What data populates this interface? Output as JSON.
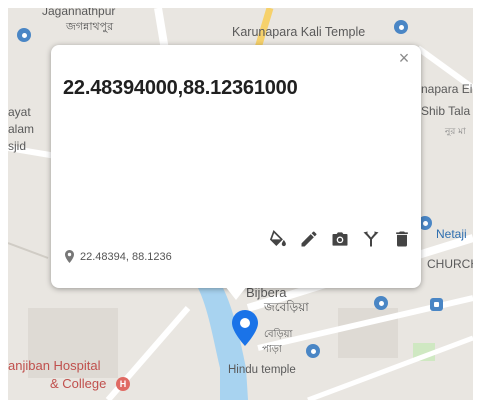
{
  "map": {
    "labels": {
      "jaganathpur_en": "Jagannathpur",
      "jaganathpur_bn": "জগন্নাথপুর",
      "karunapara_kali": "Karunapara Kali Temple",
      "napara_ei": "napara Ei",
      "shib_tala": "Shib Tala",
      "shib_tala_bn": "নুর মা",
      "ayat": "ayat",
      "alam": "alam",
      "sjid": "sjid",
      "netaji": "Netaji",
      "church": "CHURCH",
      "bijbera_en": "Bijbera",
      "bijbera_bn": "জবেড়িয়া",
      "bijbera_sub_bn": "বেড়িয়া",
      "bijbera_sub2_bn": "পাড়া",
      "hindu_temple": "Hindu temple",
      "sanjiban_1": "anjiban Hospital",
      "sanjiban_2": "& College"
    },
    "colors": {
      "land": "#e9e6e1",
      "road_major": "#ffffff",
      "road_yellow": "#f6d16b",
      "water": "#a8d3f0",
      "park": "#cfe8c2",
      "poi_blue": "#4a86c5",
      "poi_red": "#e06a63",
      "marker_blue": "#1a73e8"
    }
  },
  "popup": {
    "title": "22.48394000,88.12361000",
    "coords_short": "22.48394, 88.1236",
    "close_label": "×",
    "actions": [
      "fill-color-icon",
      "edit-icon",
      "camera-icon",
      "route-icon",
      "delete-icon"
    ]
  }
}
